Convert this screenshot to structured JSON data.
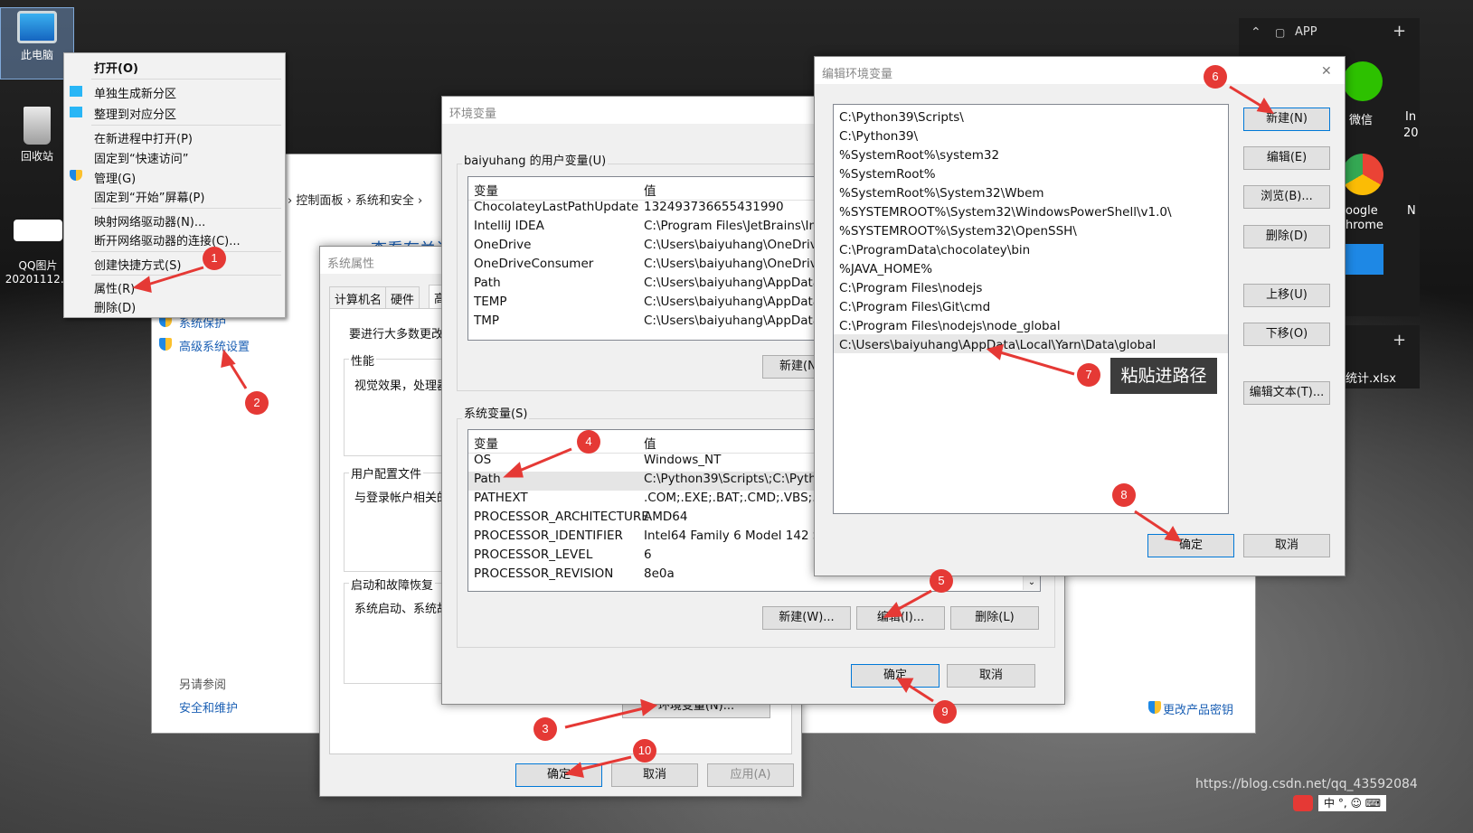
{
  "desktop": {
    "icons": [
      {
        "label": "此电脑"
      },
      {
        "label": "回收站"
      },
      {
        "label": "QQ图片\n20201112..."
      }
    ],
    "right_panel": {
      "app_label": "APP",
      "plus": "+",
      "wechat": "微信",
      "chrome_line1": "oogle",
      "chrome_line2": "hrome",
      "file": "统计.xlsx",
      "cut1": "In",
      "cut2": "20",
      "cut3": "N"
    },
    "watermark": "https://blog.csdn.net/qq_43592084",
    "tray": "中 °, ☺ ⌨"
  },
  "context_menu": {
    "items": [
      {
        "label": "打开(O)",
        "bold": true
      },
      {
        "label": "单独生成新分区",
        "icon": "monitor-icon"
      },
      {
        "label": "整理到对应分区",
        "icon": "monitor-icon"
      },
      {
        "label": "在新进程中打开(P)"
      },
      {
        "label": "固定到“快速访问”"
      },
      {
        "label": "管理(G)",
        "icon": "shield-icon"
      },
      {
        "label": "固定到“开始”屏幕(P)"
      },
      {
        "label": "映射网络驱动器(N)..."
      },
      {
        "label": "断开网络驱动器的连接(C)..."
      },
      {
        "label": "创建快捷方式(S)"
      },
      {
        "label": "属性(R)"
      },
      {
        "label": "删除(D)"
      }
    ]
  },
  "control_panel": {
    "breadcrumb": [
      "控制面板",
      "系统和安全"
    ],
    "heading_partial": "查看有关计",
    "links": [
      "系统保护",
      "高级系统设置"
    ],
    "see_also": "另请参阅",
    "security": "安全和维护",
    "change_key": "更改产品密钥"
  },
  "sysprops": {
    "title": "系统属性",
    "tabs": [
      "计算机名",
      "硬件",
      "高"
    ],
    "intro": "要进行大多数更改",
    "groups": [
      {
        "label": "性能",
        "text": "视觉效果，处理器"
      },
      {
        "label": "用户配置文件",
        "text": "与登录帐户相关的"
      },
      {
        "label": "启动和故障恢复",
        "text": "系统启动、系统故"
      }
    ],
    "env_button": "环境变量(N)...",
    "ok": "确定",
    "cancel": "取消",
    "apply": "应用(A)"
  },
  "envvars": {
    "title": "环境变量",
    "user_group": "baiyuhang 的用户变量(U)",
    "col_var": "变量",
    "col_val": "值",
    "user_vars": [
      {
        "name": "ChocolateyLastPathUpdate",
        "value": "132493736655431990"
      },
      {
        "name": "IntelliJ IDEA",
        "value": "C:\\Program Files\\JetBrains\\Inte"
      },
      {
        "name": "OneDrive",
        "value": "C:\\Users\\baiyuhang\\OneDrive"
      },
      {
        "name": "OneDriveConsumer",
        "value": "C:\\Users\\baiyuhang\\OneDrive"
      },
      {
        "name": "Path",
        "value": "C:\\Users\\baiyuhang\\AppData\\"
      },
      {
        "name": "TEMP",
        "value": "C:\\Users\\baiyuhang\\AppData\\"
      },
      {
        "name": "TMP",
        "value": "C:\\Users\\baiyuhang\\AppData\\"
      }
    ],
    "user_new": "新建(N",
    "sys_group": "系统变量(S)",
    "sys_vars": [
      {
        "name": "OS",
        "value": "Windows_NT"
      },
      {
        "name": "Path",
        "value": "C:\\Python39\\Scripts\\;C:\\Pytho"
      },
      {
        "name": "PATHEXT",
        "value": ".COM;.EXE;.BAT;.CMD;.VBS;.VB"
      },
      {
        "name": "PROCESSOR_ARCHITECTURE",
        "value": "AMD64"
      },
      {
        "name": "PROCESSOR_IDENTIFIER",
        "value": "Intel64 Family 6 Model 142 St"
      },
      {
        "name": "PROCESSOR_LEVEL",
        "value": "6"
      },
      {
        "name": "PROCESSOR_REVISION",
        "value": "8e0a"
      }
    ],
    "sys_new": "新建(W)...",
    "sys_edit": "编辑(I)...",
    "sys_delete": "删除(L)",
    "ok": "确定",
    "cancel": "取消"
  },
  "editenv": {
    "title": "编辑环境变量",
    "close": "✕",
    "paths": [
      "C:\\Python39\\Scripts\\",
      "C:\\Python39\\",
      "%SystemRoot%\\system32",
      "%SystemRoot%",
      "%SystemRoot%\\System32\\Wbem",
      "%SYSTEMROOT%\\System32\\WindowsPowerShell\\v1.0\\",
      "%SYSTEMROOT%\\System32\\OpenSSH\\",
      "C:\\ProgramData\\chocolatey\\bin",
      "%JAVA_HOME%",
      "C:\\Program Files\\nodejs",
      "C:\\Program Files\\Git\\cmd",
      "C:\\Program Files\\nodejs\\node_global",
      "C:\\Users\\baiyuhang\\AppData\\Local\\Yarn\\Data\\global"
    ],
    "buttons": {
      "new": "新建(N)",
      "edit": "编辑(E)",
      "browse": "浏览(B)...",
      "delete": "删除(D)",
      "up": "上移(U)",
      "down": "下移(O)",
      "edit_text": "编辑文本(T)...",
      "ok": "确定",
      "cancel": "取消"
    }
  },
  "annotations": {
    "badges": [
      "1",
      "2",
      "3",
      "4",
      "5",
      "6",
      "7",
      "8",
      "9",
      "10"
    ],
    "tooltip": "粘贴进路径"
  },
  "colors": {
    "badge": "#e53935",
    "arrow": "#e53935",
    "link": "#1a5fb4"
  }
}
